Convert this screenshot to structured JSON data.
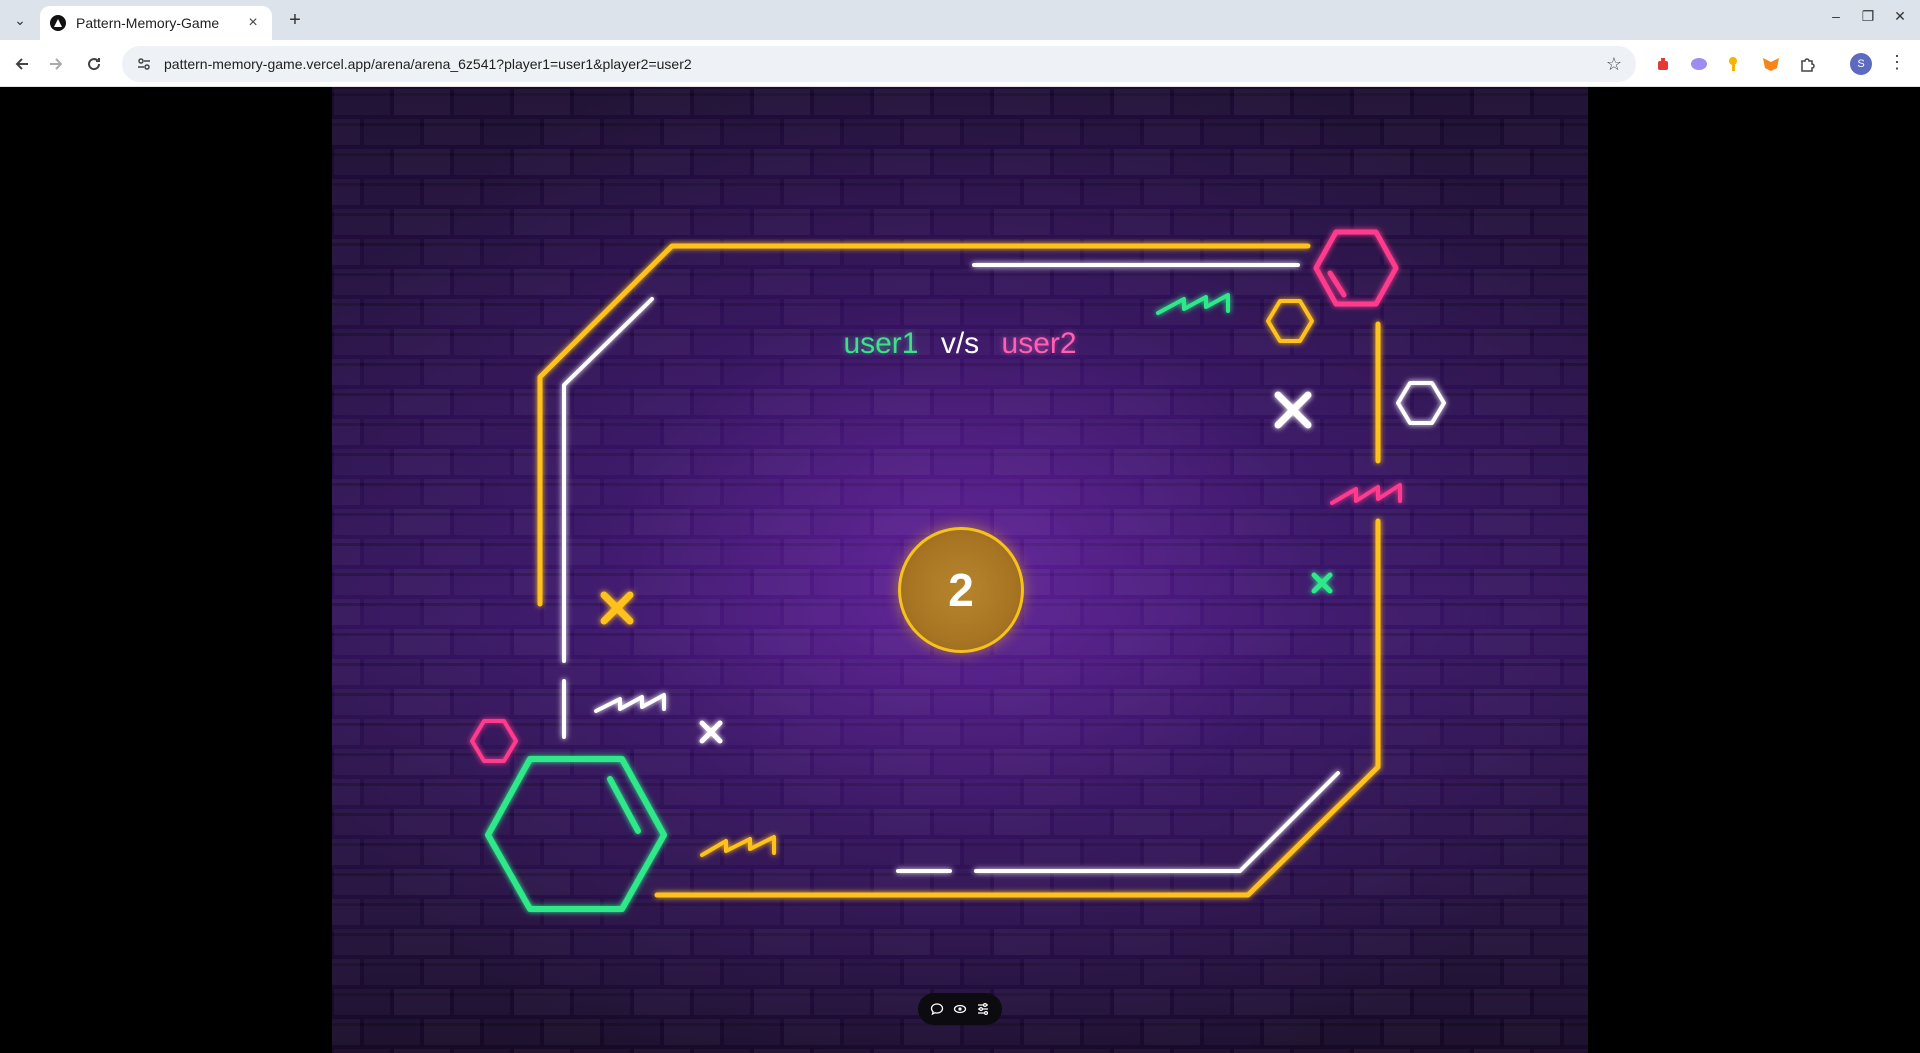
{
  "browser": {
    "tab_title": "Pattern-Memory-Game",
    "url": "pattern-memory-game.vercel.app/arena/arena_6z541?player1=user1&player2=user2",
    "avatar_initial": "S"
  },
  "game": {
    "player1": "user1",
    "vs_label": "v/s",
    "player2": "user2",
    "countdown": "2"
  },
  "colors": {
    "player1": "#3ee08a",
    "player2": "#ff5fb4",
    "frame": "#ffc21a",
    "countdown_ring": "#f6c21a"
  },
  "toolbar": {
    "icons": [
      "comment-icon",
      "eye-icon",
      "settings-sliders-icon"
    ]
  }
}
